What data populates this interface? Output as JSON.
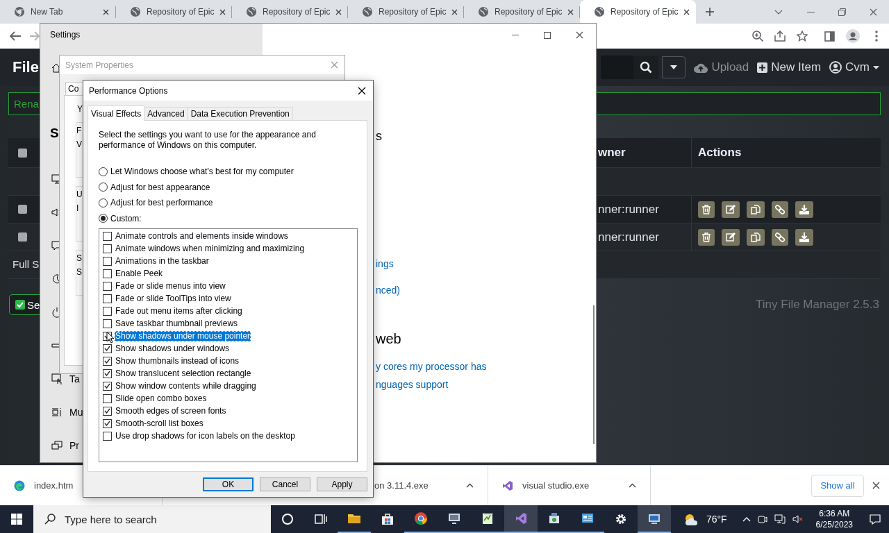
{
  "browser": {
    "tabs": [
      {
        "kind": "newtab",
        "label": "New Tab",
        "selected": false
      },
      {
        "kind": "page",
        "label": "Repository of Epic",
        "selected": false
      },
      {
        "kind": "page",
        "label": "Repository of Epic",
        "selected": false
      },
      {
        "kind": "page",
        "label": "Repository of Epic",
        "selected": false
      },
      {
        "kind": "page",
        "label": "Repository of Epic",
        "selected": false
      },
      {
        "kind": "page",
        "label": "Repository of Epic",
        "selected": true
      }
    ]
  },
  "file_manager": {
    "brand": "File",
    "upload": {
      "label": "Upload",
      "disabled": true
    },
    "new_item": {
      "label": "New Item",
      "disabled": false
    },
    "user": "Cvm",
    "alert": "Rena",
    "table": {
      "columns": [
        "wner",
        "Actions"
      ],
      "header_checkbox": {
        "checked": false
      },
      "rows": [
        {
          "kind": "parent"
        },
        {
          "kind": "file",
          "checked": false,
          "owner": "nner:runner"
        },
        {
          "kind": "file",
          "checked": false,
          "owner": "nner:runner"
        },
        {
          "kind": "summary",
          "text": "Full S"
        }
      ]
    },
    "select_button": "Se",
    "footer": "Tiny File Manager 2.5.3"
  },
  "settings_window": {
    "title": "Settings",
    "heading": "S",
    "nav": [
      {
        "kind": "icon"
      },
      {
        "kind": "icon"
      },
      {
        "kind": "icon"
      },
      {
        "kind": "icon"
      },
      {
        "kind": "icon"
      },
      {
        "kind": "icon"
      },
      {
        "kind": "entry",
        "label": "Ta"
      },
      {
        "kind": "entry",
        "label": "Mu"
      },
      {
        "kind": "entry",
        "label": "Pr"
      }
    ],
    "content": [
      {
        "kind": "heading",
        "text": "s"
      },
      {
        "kind": "link",
        "text": "ings"
      },
      {
        "kind": "link",
        "text": "nced)"
      },
      {
        "kind": "heading",
        "text": "web"
      },
      {
        "kind": "link",
        "text": "y cores my processor has"
      },
      {
        "kind": "link",
        "text": "nguages support"
      }
    ]
  },
  "system_properties": {
    "title": "System Properties",
    "tab": "Co",
    "intro": "Y",
    "groups": [
      {
        "lines": [
          "F",
          "V"
        ]
      },
      {
        "lines": [
          "U",
          "I"
        ]
      },
      {
        "lines": [
          "S",
          "S"
        ]
      }
    ]
  },
  "performance_options": {
    "title": "Performance Options",
    "tabs": [
      {
        "label": "Visual Effects",
        "selected": true
      },
      {
        "label": "Advanced",
        "selected": false
      },
      {
        "label": "Data Execution Prevention",
        "selected": false
      }
    ],
    "description": "Select the settings you want to use for the appearance and performance of Windows on this computer.",
    "options": [
      {
        "label": "Let Windows choose what's best for my computer",
        "selected": false
      },
      {
        "label": "Adjust for best appearance",
        "selected": false
      },
      {
        "label": "Adjust for best performance",
        "selected": false
      },
      {
        "label": "Custom:",
        "selected": true
      }
    ],
    "effects": [
      {
        "label": "Animate controls and elements inside windows",
        "checked": false,
        "selected": false
      },
      {
        "label": "Animate windows when minimizing and maximizing",
        "checked": false,
        "selected": false
      },
      {
        "label": "Animations in the taskbar",
        "checked": false,
        "selected": false
      },
      {
        "label": "Enable Peek",
        "checked": false,
        "selected": false
      },
      {
        "label": "Fade or slide menus into view",
        "checked": false,
        "selected": false
      },
      {
        "label": "Fade or slide ToolTips into view",
        "checked": false,
        "selected": false
      },
      {
        "label": "Fade out menu items after clicking",
        "checked": false,
        "selected": false
      },
      {
        "label": "Save taskbar thumbnail previews",
        "checked": false,
        "selected": false
      },
      {
        "label": "Show shadows under mouse pointer",
        "checked": true,
        "selected": true
      },
      {
        "label": "Show shadows under windows",
        "checked": true,
        "selected": false
      },
      {
        "label": "Show thumbnails instead of icons",
        "checked": true,
        "selected": false
      },
      {
        "label": "Show translucent selection rectangle",
        "checked": true,
        "selected": false
      },
      {
        "label": "Show window contents while dragging",
        "checked": true,
        "selected": false
      },
      {
        "label": "Slide open combo boxes",
        "checked": false,
        "selected": false
      },
      {
        "label": "Smooth edges of screen fonts",
        "checked": true,
        "selected": false
      },
      {
        "label": "Smooth-scroll list boxes",
        "checked": true,
        "selected": false
      },
      {
        "label": "Use drop shadows for icon labels on the desktop",
        "checked": false,
        "selected": false
      }
    ],
    "buttons": [
      {
        "label": "OK",
        "default": true
      },
      {
        "label": "Cancel",
        "default": false
      },
      {
        "label": "Apply",
        "default": false
      }
    ]
  },
  "downloads": {
    "items": [
      {
        "kind": "page",
        "name": "index.htm"
      },
      {
        "kind": "installer",
        "name": "on 3.11.4.exe"
      },
      {
        "kind": "app",
        "name": "visual studio.exe"
      }
    ],
    "show_all": "Show all"
  },
  "taskbar": {
    "search": {
      "placeholder": "Type here to search"
    },
    "apps": [
      {
        "kind": "cortana",
        "running": false,
        "active": false
      },
      {
        "kind": "taskview",
        "running": false,
        "active": false
      },
      {
        "kind": "folder",
        "running": true,
        "active": false
      },
      {
        "kind": "store",
        "running": false,
        "active": false
      },
      {
        "kind": "chrome",
        "running": true,
        "active": false
      },
      {
        "kind": "monitor",
        "running": true,
        "active": false
      },
      {
        "kind": "editor",
        "running": true,
        "active": false
      },
      {
        "kind": "studio",
        "running": true,
        "active": true
      },
      {
        "kind": "setup",
        "running": true,
        "active": false
      },
      {
        "kind": "panel",
        "running": true,
        "active": false
      },
      {
        "kind": "gear",
        "running": false,
        "active": false
      },
      {
        "kind": "remote",
        "running": true,
        "active": true
      }
    ],
    "weather": "76°F",
    "clock": {
      "time": "6:36 AM",
      "date": "6/25/2023"
    }
  }
}
